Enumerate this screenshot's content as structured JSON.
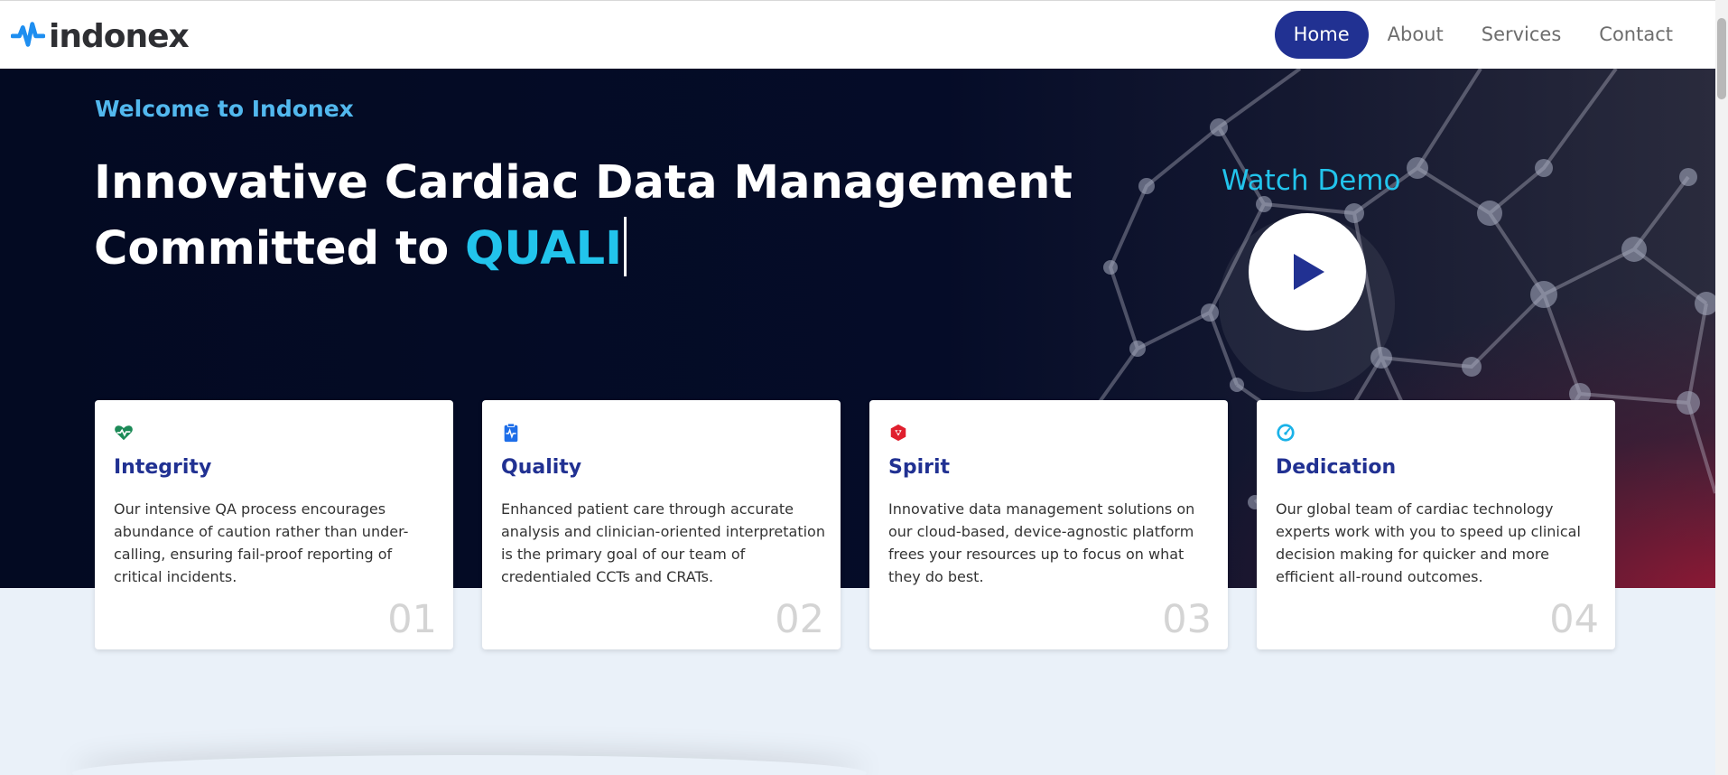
{
  "brand": {
    "name": "indonex",
    "logo_icon": "pulse-icon",
    "logo_color": "#1e8ef0"
  },
  "nav": {
    "items": [
      {
        "label": "Home",
        "active": true
      },
      {
        "label": "About",
        "active": false
      },
      {
        "label": "Services",
        "active": false
      },
      {
        "label": "Contact",
        "active": false
      }
    ]
  },
  "hero": {
    "kicker": "Welcome to Indonex",
    "line1": "Innovative Cardiac Data Management",
    "line2_prefix": "Committed to ",
    "line2_accent": "QUALI",
    "demo_label": "Watch Demo",
    "play_icon": "play-icon"
  },
  "cards": [
    {
      "icon": "heart-pulse-icon",
      "icon_color": "#1c8a57",
      "title": "Integrity",
      "text": "Our intensive QA process encourages abundance of caution rather than under-calling, ensuring fail-proof reporting of critical incidents.",
      "number": "01"
    },
    {
      "icon": "clipboard-pulse-icon",
      "icon_color": "#1e6ee8",
      "title": "Quality",
      "text": "Enhanced patient care through accurate analysis and clinician-oriented interpretation is the primary goal of our team of credentialed CCTs and CRATs.",
      "number": "02"
    },
    {
      "icon": "spirit-icon",
      "icon_color": "#e01f2e",
      "title": "Spirit",
      "text": "Innovative data management solutions on our cloud-based, device-agnostic platform frees your resources up to focus on what they do best.",
      "number": "03"
    },
    {
      "icon": "gauge-icon",
      "icon_color": "#1ab2e8",
      "title": "Dedication",
      "text": "Our global team of cardiac technology experts work with you to speed up clinical decision making for quicker and more efficient all-round outcomes.",
      "number": "04"
    }
  ],
  "colors": {
    "primary": "#213192",
    "accent": "#22c4ec",
    "kicker": "#52b8ee",
    "hero_bg": "#030a22"
  }
}
